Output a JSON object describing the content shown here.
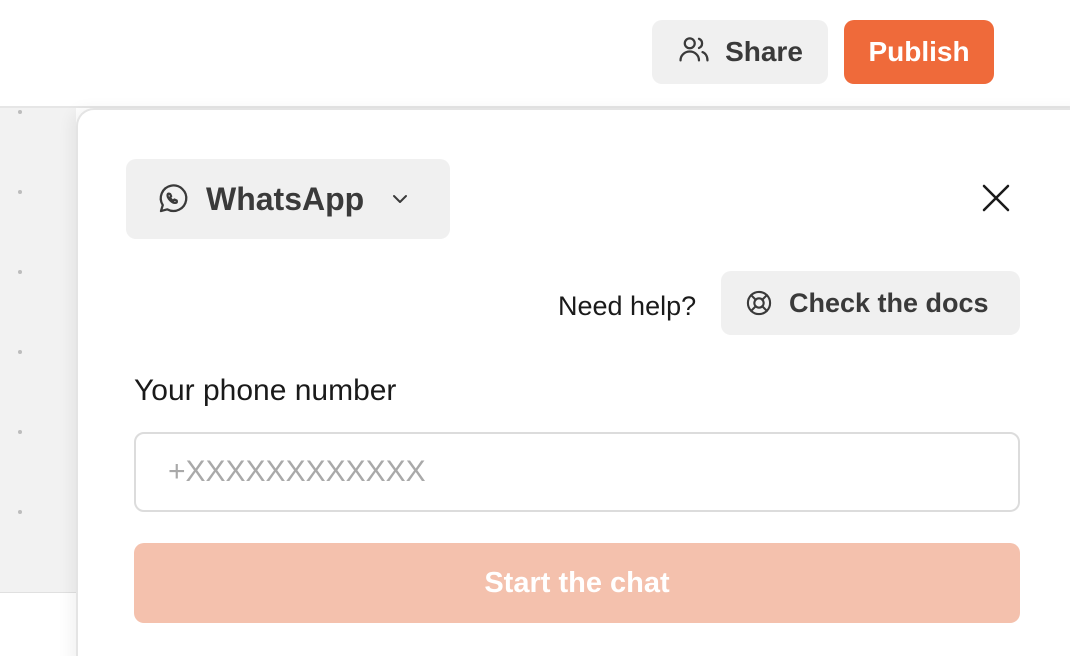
{
  "header": {
    "share_label": "Share",
    "publish_label": "Publish"
  },
  "panel": {
    "channel": {
      "selected": "WhatsApp",
      "icon": "whatsapp-icon"
    },
    "help": {
      "prompt": "Need help?",
      "docs_label": "Check the docs",
      "docs_icon": "lifebuoy-icon"
    },
    "phone": {
      "label": "Your phone number",
      "placeholder": "+XXXXXXXXXXXX",
      "value": ""
    },
    "start_label": "Start the chat"
  },
  "colors": {
    "accent": "#ef6a3a",
    "accent_disabled": "#f4c1ad",
    "button_bg": "#f0f0f0",
    "canvas_bg": "#f2f2f2"
  }
}
